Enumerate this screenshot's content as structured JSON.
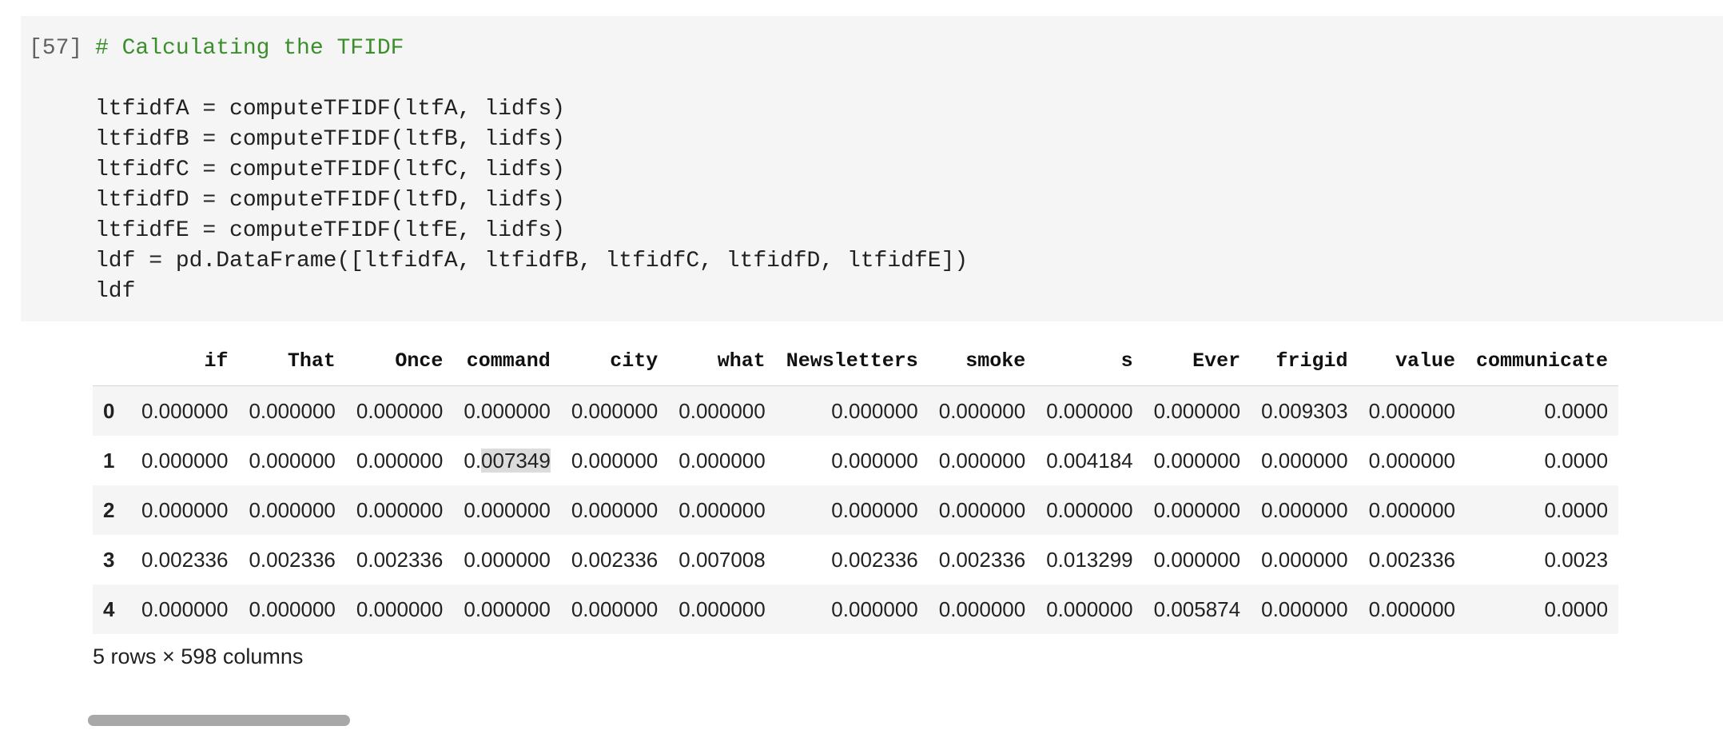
{
  "cell": {
    "execution_count": "[57]",
    "code_lines": [
      {
        "text": "# Calculating the TFIDF",
        "kind": "comment"
      },
      {
        "text": "",
        "kind": "code"
      },
      {
        "text": "ltfidfA = computeTFIDF(ltfA, lidfs)",
        "kind": "code"
      },
      {
        "text": "ltfidfB = computeTFIDF(ltfB, lidfs)",
        "kind": "code"
      },
      {
        "text": "ltfidfC = computeTFIDF(ltfC, lidfs)",
        "kind": "code"
      },
      {
        "text": "ltfidfD = computeTFIDF(ltfD, lidfs)",
        "kind": "code"
      },
      {
        "text": "ltfidfE = computeTFIDF(ltfE, lidfs)",
        "kind": "code"
      },
      {
        "text": "ldf = pd.DataFrame([ltfidfA, ltfidfB, ltfidfC, ltfidfD, ltfidfE])",
        "kind": "code"
      },
      {
        "text": "ldf",
        "kind": "code"
      }
    ]
  },
  "dataframe": {
    "columns": [
      "if",
      "That",
      "Once",
      "command",
      "city",
      "what",
      "Newsletters",
      "smoke",
      "s",
      "Ever",
      "frigid",
      "value",
      "communicate"
    ],
    "rows": [
      {
        "index": "0",
        "values": [
          "0.000000",
          "0.000000",
          "0.000000",
          "0.000000",
          "0.000000",
          "0.000000",
          "0.000000",
          "0.000000",
          "0.000000",
          "0.000000",
          "0.009303",
          "0.000000",
          "0.0000"
        ]
      },
      {
        "index": "1",
        "values": [
          "0.000000",
          "0.000000",
          "0.000000",
          "0.007349",
          "0.000000",
          "0.000000",
          "0.000000",
          "0.000000",
          "0.004184",
          "0.000000",
          "0.000000",
          "0.000000",
          "0.0000"
        ]
      },
      {
        "index": "2",
        "values": [
          "0.000000",
          "0.000000",
          "0.000000",
          "0.000000",
          "0.000000",
          "0.000000",
          "0.000000",
          "0.000000",
          "0.000000",
          "0.000000",
          "0.000000",
          "0.000000",
          "0.0000"
        ]
      },
      {
        "index": "3",
        "values": [
          "0.002336",
          "0.002336",
          "0.002336",
          "0.000000",
          "0.002336",
          "0.007008",
          "0.002336",
          "0.002336",
          "0.013299",
          "0.000000",
          "0.000000",
          "0.002336",
          "0.0023"
        ]
      },
      {
        "index": "4",
        "values": [
          "0.000000",
          "0.000000",
          "0.000000",
          "0.000000",
          "0.000000",
          "0.000000",
          "0.000000",
          "0.000000",
          "0.000000",
          "0.005874",
          "0.000000",
          "0.000000",
          "0.0000"
        ]
      }
    ],
    "selected_cell": {
      "row": 1,
      "col": 3,
      "prefix": "0.",
      "selected_text": "007349"
    },
    "shape_text": "5 rows × 598 columns"
  },
  "colors": {
    "cell_background": "#f5f5f5",
    "comment": "#3b8f2b",
    "selection": "#dcdcdc",
    "scrollbar_thumb": "#a8a8a8"
  }
}
